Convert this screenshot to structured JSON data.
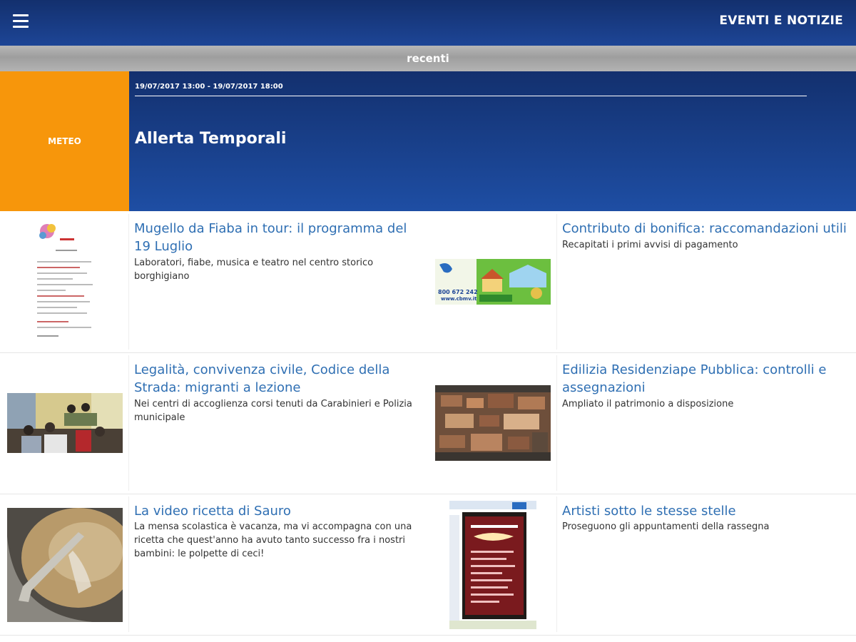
{
  "header": {
    "menu_icon": "hamburger-menu-icon",
    "title": "EVENTI E NOTIZIE",
    "colors": {
      "topbar_start": "#13306e",
      "topbar_end": "#1d4596"
    }
  },
  "subheader": {
    "label": "recenti"
  },
  "featured": {
    "category": "METEO",
    "date_range": "19/07/2017 13:00 - 19/07/2017 18:00",
    "title": "Allerta Temporali",
    "colors": {
      "category_bg": "#f7960b"
    }
  },
  "news": [
    {
      "title": "Mugello da Fiaba in tour: il programma del 19 Luglio",
      "description": "Laboratori, fiabe, musica e teatro nel centro storico borghigiano"
    },
    {
      "title": "Contributo di bonifica: raccomandazioni utili",
      "description": "Recapitati i primi avvisi di pagamento"
    },
    {
      "title": "Legalità, convivenza civile, Codice della Strada: migranti a lezione",
      "description": "Nei centri di accoglienza corsi tenuti da Carabinieri e Polizia municipale"
    },
    {
      "title": "Edilizia Residenziape Pubblica: controlli e assegnazioni",
      "description": "Ampliato il patrimonio a disposizione"
    },
    {
      "title": "La video ricetta di Sauro",
      "description": "La mensa scolastica è vacanza, ma vi accompagna con una ricetta che quest'anno ha avuto tanto successo fra i nostri bambini: le polpette di ceci!"
    },
    {
      "title": "Artisti sotto le stesse stelle",
      "description": "Proseguono gli appuntamenti della rassegna"
    }
  ],
  "thumb_texts": {
    "bonifica_phone": "800 672 242",
    "bonifica_site": "www.cbmv.it"
  },
  "link_color": "#2f6fb3"
}
